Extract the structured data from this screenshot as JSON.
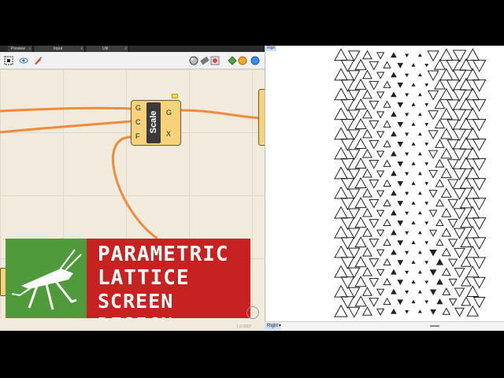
{
  "gh_tabs": [
    {
      "label": "Preview",
      "close": "x"
    },
    {
      "label": "Input",
      "close": "x"
    },
    {
      "label": "Util",
      "close": "x"
    }
  ],
  "toolbar": {
    "icons": [
      "cursor-select-icon",
      "eye-preview-icon",
      "paint-brush-icon",
      "shaded-sphere-icon",
      "wire-display-icon",
      "bake-icon",
      "recompute-icon",
      "color-sphere-icon",
      "blue-sphere-icon"
    ]
  },
  "component": {
    "name": "Scale",
    "inputs": [
      "G",
      "C",
      "F"
    ],
    "outputs": [
      "G",
      "X"
    ]
  },
  "banner": {
    "lines": [
      "PARAMETRIC",
      "LATTICE",
      "SCREEN DESIGN"
    ],
    "logo": "grasshopper-logo-icon",
    "logo_color": "#4f9a3b",
    "red_color": "#c62222"
  },
  "status": {
    "version": "1.0.0007"
  },
  "viewport": {
    "top_tag": "Righ",
    "bottom_label": "Right",
    "dropdown": "▾"
  },
  "colors": {
    "wire": "#f08a3c",
    "canvas": "#f0ebdc",
    "component": "#f6d27a"
  }
}
